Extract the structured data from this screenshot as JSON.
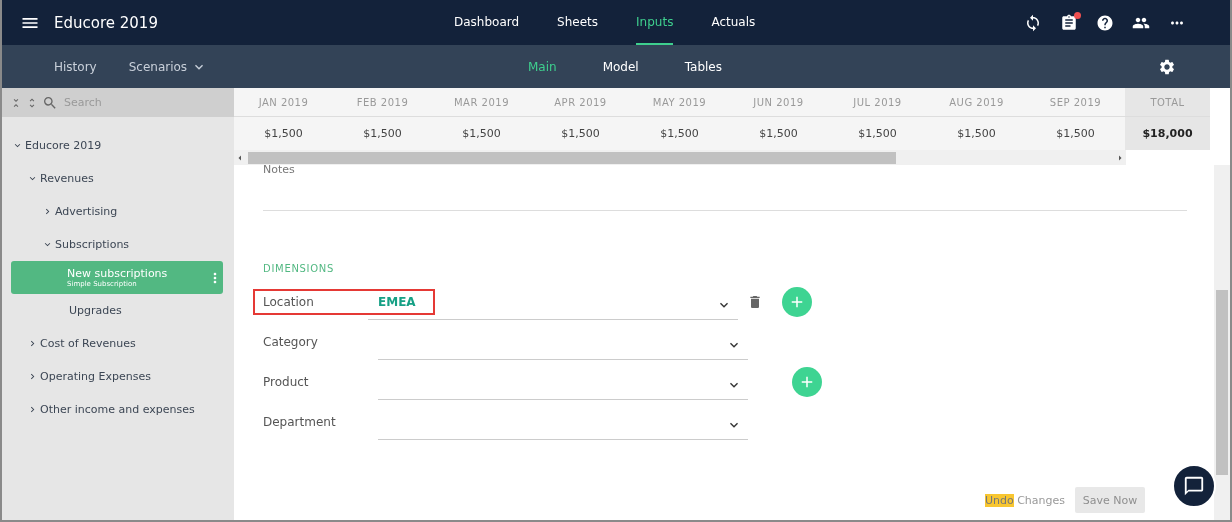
{
  "app": {
    "title": "Educore 2019"
  },
  "nav_tabs": [
    {
      "label": "Dashboard",
      "selected": false
    },
    {
      "label": "Sheets",
      "selected": false
    },
    {
      "label": "Inputs",
      "selected": true
    },
    {
      "label": "Actuals",
      "selected": false
    }
  ],
  "header_icons": [
    {
      "kind": "sync",
      "badge": false
    },
    {
      "kind": "clipboard",
      "badge": true
    },
    {
      "kind": "help",
      "badge": false
    },
    {
      "kind": "people",
      "badge": false
    },
    {
      "kind": "more",
      "badge": false
    }
  ],
  "sub_left": [
    {
      "label": "History",
      "dropdown": false
    },
    {
      "label": "Scenarios",
      "dropdown": true
    }
  ],
  "sub_tabs": [
    {
      "label": "Main",
      "selected": true
    },
    {
      "label": "Model",
      "selected": false
    },
    {
      "label": "Tables",
      "selected": false
    }
  ],
  "sidebar": {
    "search_placeholder": "Search",
    "tree": [
      {
        "label": "Educore 2019",
        "expanded": true,
        "selected": false,
        "children": [
          {
            "label": "Revenues",
            "expanded": true,
            "selected": false,
            "children": [
              {
                "label": "Advertising",
                "expanded": false,
                "selected": false
              },
              {
                "label": "Subscriptions",
                "expanded": true,
                "selected": false,
                "children": [
                  {
                    "label": "New subscriptions",
                    "subtitle": "Simple Subscription",
                    "selected": true
                  },
                  {
                    "label": "Upgrades",
                    "selected": false
                  }
                ]
              }
            ]
          },
          {
            "label": "Cost of Revenues",
            "expanded": false,
            "selected": false
          },
          {
            "label": "Operating Expenses",
            "expanded": false,
            "selected": false
          },
          {
            "label": "Other income and expenses",
            "expanded": false,
            "selected": false
          }
        ]
      }
    ]
  },
  "table": {
    "columns": [
      "JAN 2019",
      "FEB 2019",
      "MAR 2019",
      "APR 2019",
      "MAY 2019",
      "JUN 2019",
      "JUL 2019",
      "AUG 2019",
      "SEP 2019"
    ],
    "values": [
      "$1,500",
      "$1,500",
      "$1,500",
      "$1,500",
      "$1,500",
      "$1,500",
      "$1,500",
      "$1,500",
      "$1,500"
    ],
    "total_label": "TOTAL",
    "total_value": "$18,000"
  },
  "notes": {
    "label": "Notes"
  },
  "dimensions": {
    "heading": "DIMENSIONS",
    "rows": [
      {
        "label": "Location",
        "value": "EMEA",
        "deletable": true,
        "addable": true,
        "highlighted": true
      },
      {
        "label": "Category",
        "deletable": false,
        "addable": false,
        "highlighted": false
      },
      {
        "label": "Product",
        "deletable": false,
        "addable": true,
        "highlighted": false
      },
      {
        "label": "Department",
        "deletable": false,
        "addable": false,
        "highlighted": false
      }
    ]
  },
  "footer": {
    "undo": [
      {
        "text": "Undo",
        "highlighted": true
      },
      {
        "text": "Changes",
        "highlighted": false
      }
    ],
    "save": {
      "label": "Save Now",
      "disabled": true
    }
  }
}
